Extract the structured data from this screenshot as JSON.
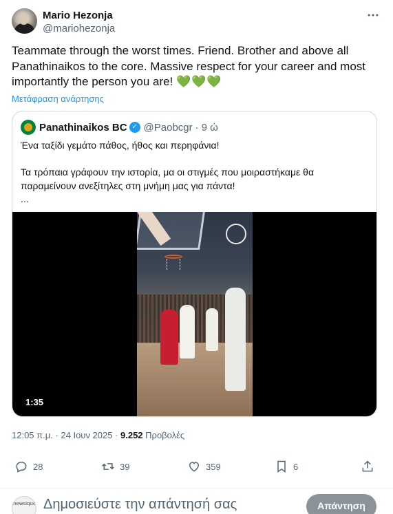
{
  "author": {
    "display_name": "Mario Hezonja",
    "handle": "@mariohezonja",
    "more_icon": "more-dots-icon"
  },
  "tweet": {
    "text": "Teammate through the worst times. Friend. Brother and above all Panathinaikos to the core. Massive respect for your career and most importantly the person you are!",
    "emoji": "💚💚💚",
    "translate_link": "Μετάφραση ανάρτησης"
  },
  "quoted": {
    "name": "Panathinaikos BC",
    "verified_icon": "verified-badge-icon",
    "handle": "@Paobcgr",
    "separator": "·",
    "time": "9 ώ",
    "text": "Ένα ταξίδι γεμάτο πάθος, ήθος και περηφάνια!\n\nΤα τρόπαια γράφουν την ιστορία, μα οι στιγμές που μοιραστήκαμε θα παραμείνουν ανεξίτηλες στη μνήμη μας για πάντα!\n...",
    "video_duration": "1:35"
  },
  "meta": {
    "timestamp": "12:05 π.μ. · 24 Ιουν 2025 · ",
    "views_count": "9.252",
    "views_label": " Προβολές"
  },
  "actions": {
    "replies": "28",
    "reposts": "39",
    "likes": "359",
    "bookmarks": "6"
  },
  "reply_box": {
    "avatar_text": "newsique",
    "placeholder": "Δημοσιεύστε την απάντησή σας",
    "button_label": "Απάντηση"
  },
  "colors": {
    "accent": "#1d9bf0",
    "secondary_text": "#536471",
    "hearts": "#6cc04a",
    "reply_button": "#8b9399"
  }
}
